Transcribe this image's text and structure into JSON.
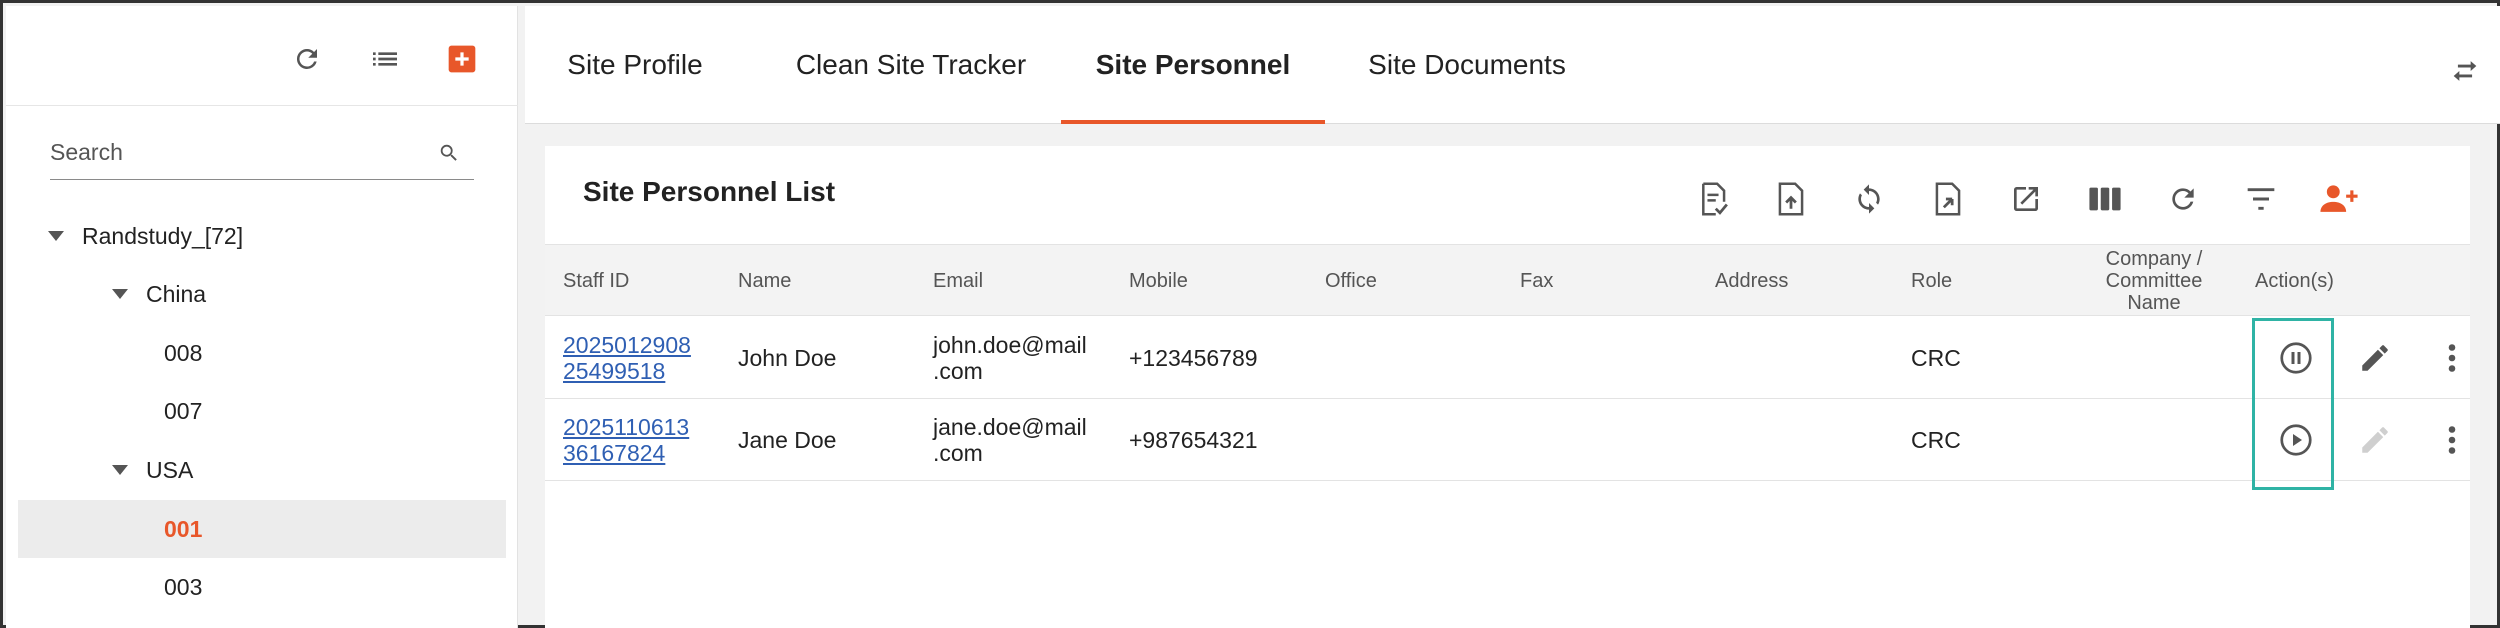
{
  "sidebar": {
    "search_placeholder": "Search",
    "tree": [
      {
        "label": "Randstudy_[72]",
        "level": 0,
        "expanded": true
      },
      {
        "label": "China",
        "level": 1,
        "expanded": true
      },
      {
        "label": "008",
        "level": 2
      },
      {
        "label": "007",
        "level": 2
      },
      {
        "label": "USA",
        "level": 1,
        "expanded": true
      },
      {
        "label": "001",
        "level": 2,
        "selected": true
      },
      {
        "label": "003",
        "level": 2
      }
    ]
  },
  "tabs": [
    {
      "label": "Site Profile"
    },
    {
      "label": "Clean Site Tracker"
    },
    {
      "label": "Site Personnel",
      "active": true
    },
    {
      "label": "Site Documents"
    }
  ],
  "card": {
    "title": "Site Personnel List",
    "toolbar_icons": [
      "checklist-icon",
      "upload-icon",
      "sync-icon",
      "import-icon",
      "open-external-icon",
      "columns-icon",
      "refresh-icon",
      "filter-icon",
      "add-user-icon"
    ]
  },
  "table": {
    "headers": {
      "staff_id": "Staff ID",
      "name": "Name",
      "email": "Email",
      "mobile": "Mobile",
      "office": "Office",
      "fax": "Fax",
      "address": "Address",
      "role": "Role",
      "company": "Company / Committee Name",
      "actions": "Action(s)"
    },
    "rows": [
      {
        "staff_id_1": "2025012908",
        "staff_id_2": "25499518",
        "name": "John Doe",
        "email_1": "john.doe@mail",
        "email_2": ".com",
        "mobile": "+123456789",
        "office": "",
        "fax": "",
        "address": "",
        "role": "CRC",
        "company": "",
        "status_action": "pause-icon",
        "edit_enabled": true
      },
      {
        "staff_id_1": "2025110613",
        "staff_id_2": "36167824",
        "name": "Jane Doe",
        "email_1": "jane.doe@mail",
        "email_2": ".com",
        "mobile": "+987654321",
        "office": "",
        "fax": "",
        "address": "",
        "role": "CRC",
        "company": "",
        "status_action": "play-icon",
        "edit_enabled": false
      }
    ]
  },
  "colors": {
    "accent": "#e8572a",
    "highlight": "#2fb3a5",
    "link": "#2f5fb3"
  }
}
